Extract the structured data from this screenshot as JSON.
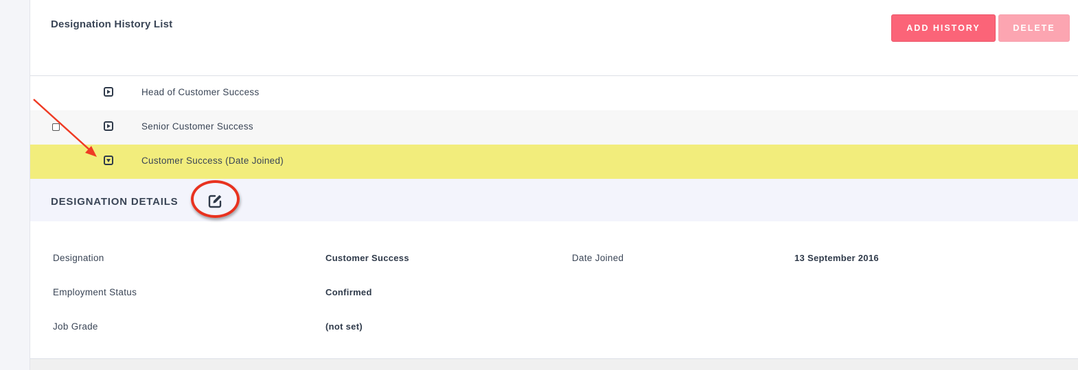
{
  "panel": {
    "title": "Designation History List"
  },
  "toolbar": {
    "add_label": "ADD HISTORY",
    "delete_label": "DELETE"
  },
  "history_rows": [
    {
      "label": "Head of Customer Success",
      "expanded": false
    },
    {
      "label": "Senior Customer Success",
      "expanded": false
    },
    {
      "label": "Customer Success (Date Joined)",
      "expanded": true
    }
  ],
  "details": {
    "title": "DESIGNATION DETAILS",
    "fields": {
      "designation": {
        "label": "Designation",
        "value": "Customer Success"
      },
      "date_joined": {
        "label": "Date Joined",
        "value": "13 September 2016"
      },
      "employment_status": {
        "label": "Employment Status",
        "value": "Confirmed"
      },
      "job_grade": {
        "label": "Job Grade",
        "value": "(not set)"
      }
    }
  },
  "colors": {
    "accent": "#fb6478",
    "accent_disabled": "#fca5b1",
    "selected_row": "#f2ed7c",
    "details_header_bg": "#f3f4fc",
    "annotation": "#e8321f"
  },
  "icons": {
    "row_collapsed": "caret-right-square-icon",
    "row_expanded": "caret-down-square-icon",
    "edit": "edit-icon"
  }
}
